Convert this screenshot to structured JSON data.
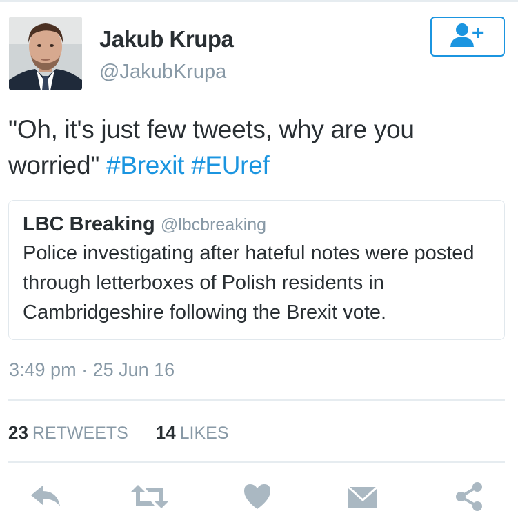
{
  "user": {
    "name": "Jakub Krupa",
    "handle": "@JakubKrupa"
  },
  "tweet": {
    "text_prefix": "\"Oh, it's just few tweets, why are you worried\"",
    "hashtags": [
      "#Brexit",
      "#EUref"
    ]
  },
  "quoted": {
    "name": "LBC Breaking",
    "handle": "@lbcbreaking",
    "text": "Police investigating after hateful notes were posted through letterboxes of Polish residents in Cambridgeshire following the Brexit vote."
  },
  "meta": {
    "time": "3:49 pm",
    "separator": "·",
    "date": "25 Jun 16"
  },
  "stats": {
    "retweets_count": "23",
    "retweets_label": "RETWEETS",
    "likes_count": "14",
    "likes_label": "LIKES"
  },
  "icons": {
    "follow": "add-user-icon",
    "reply": "reply-icon",
    "retweet": "retweet-icon",
    "like": "heart-icon",
    "dm": "envelope-icon",
    "share": "share-icon"
  },
  "colors": {
    "accent": "#1b95e0",
    "text": "#292f33",
    "muted": "#8899a6",
    "action_icon": "#aab8c2"
  }
}
